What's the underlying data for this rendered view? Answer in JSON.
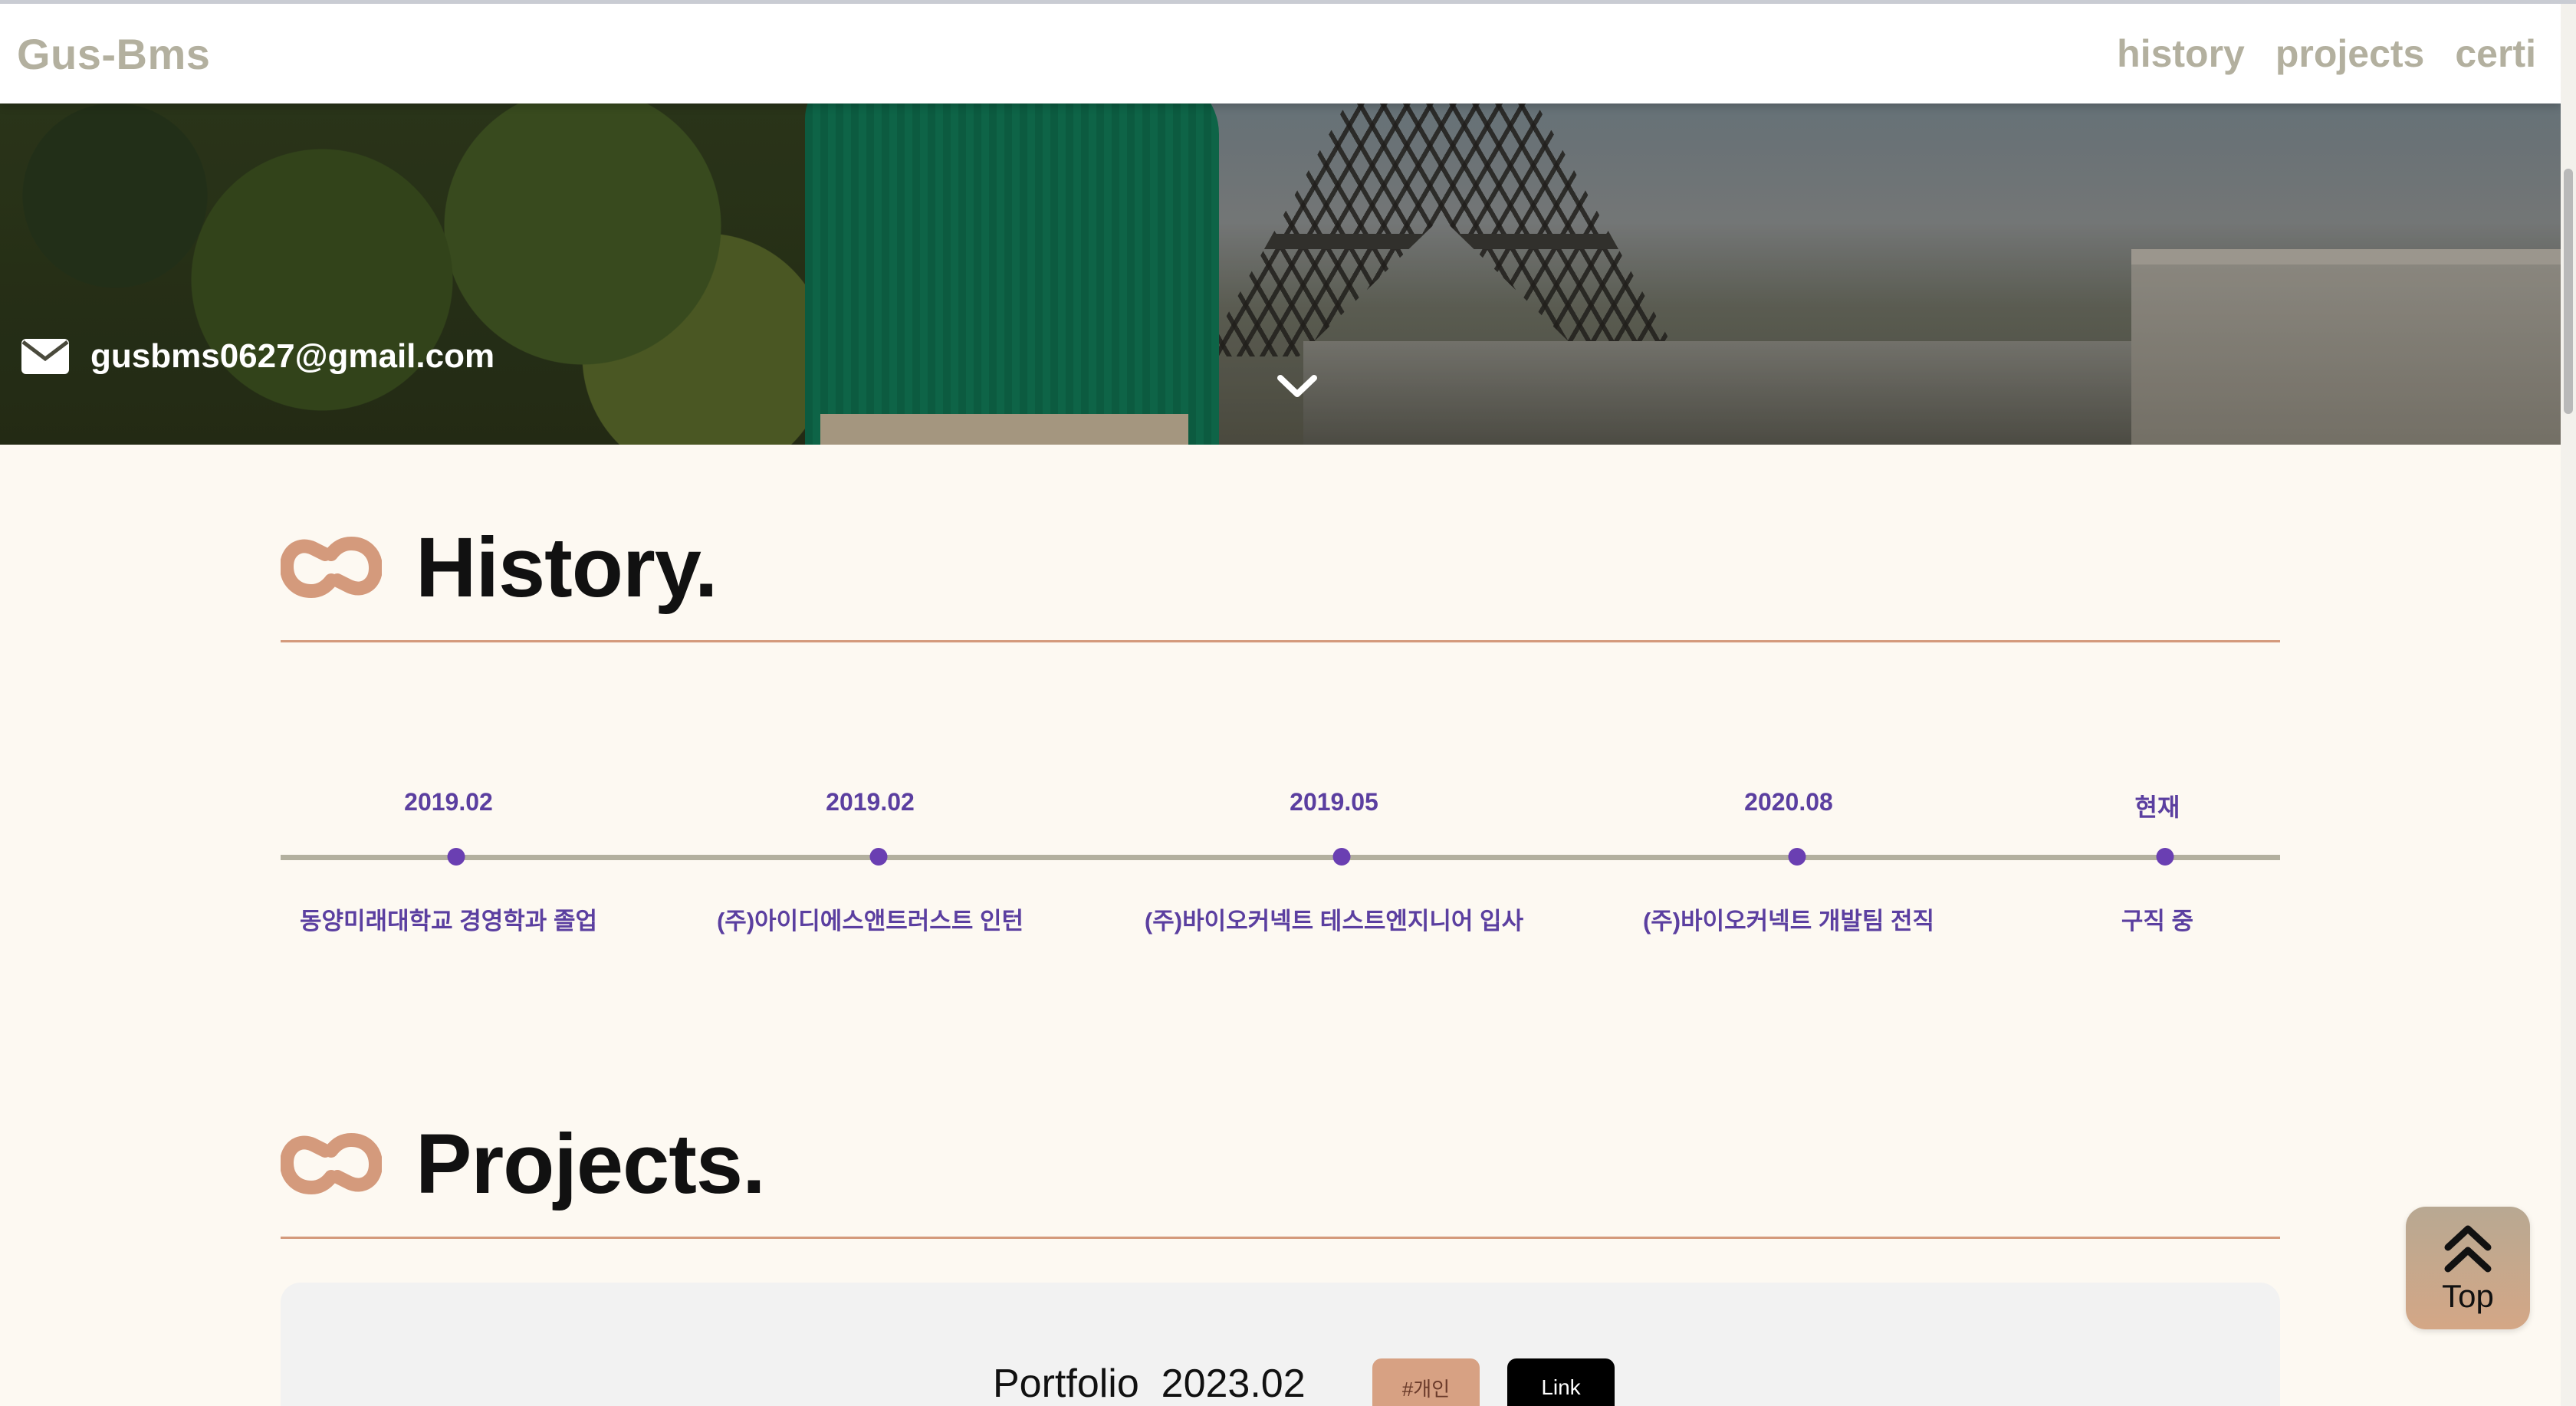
{
  "navbar": {
    "brand": "Gus-Bms",
    "links": [
      "history",
      "projects",
      "certi"
    ]
  },
  "hero": {
    "email": "gusbms0627@gmail.com",
    "mail_icon": "envelope-icon",
    "scroll_icon": "chevron-down-icon"
  },
  "history": {
    "title": "History.",
    "icon": "link-icon",
    "timeline": [
      {
        "date": "2019.02",
        "label": "동양미래대학교 경영학과 졸업"
      },
      {
        "date": "2019.02",
        "label": "(주)아이디에스앤트러스트 인턴"
      },
      {
        "date": "2019.05",
        "label": "(주)바이오커넥트 테스트엔지니어 입사"
      },
      {
        "date": "2020.08",
        "label": "(주)바이오커넥트 개발팀 전직"
      },
      {
        "date": "현재",
        "label": "구직 중"
      }
    ]
  },
  "projects": {
    "title": "Projects.",
    "icon": "link-icon",
    "items": [
      {
        "title": "Portfolio  2023.02",
        "tag": "#개인",
        "link_label": "Link"
      }
    ]
  },
  "top_button": {
    "label": "Top",
    "icon": "double-chevron-up-icon"
  },
  "colors": {
    "accent": "#d49a7c",
    "timeline_text": "#5b3fa0",
    "timeline_dot": "#6a3fb2",
    "nav_text": "#b3b09f",
    "page_bg": "#fdf9f2"
  }
}
